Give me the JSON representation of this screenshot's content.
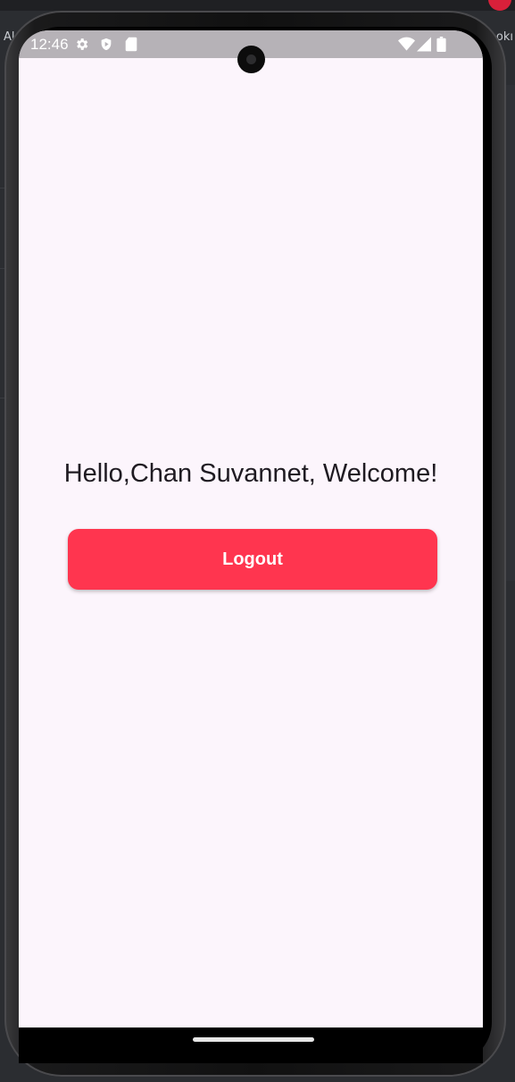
{
  "desktop": {
    "left_text": "Al",
    "right_text": "okı"
  },
  "status_bar": {
    "time": "12:46",
    "left_icons": [
      "gear-icon",
      "shield-play-icon",
      "sd-card-icon"
    ],
    "right_icons": [
      "wifi-icon",
      "signal-icon",
      "battery-icon"
    ]
  },
  "main": {
    "welcome_text": "Hello,Chan Suvannet, Welcome!",
    "logout_label": "Logout"
  },
  "colors": {
    "background": "#fcf5fc",
    "button": "#ff354f",
    "status_bar": "#b6b2b7"
  }
}
